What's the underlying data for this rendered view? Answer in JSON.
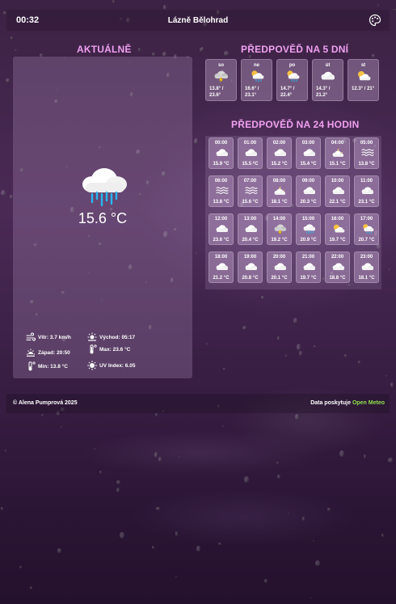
{
  "header": {
    "time": "00:32",
    "city": "Lázně Bělohrad",
    "settings_icon": "palette-icon"
  },
  "current": {
    "title": "AKTUÁLNĚ",
    "icon": "rain-cloud-icon",
    "temperature": "15.6 °C",
    "details": {
      "wind": "Vítr: 3.7 km/h",
      "sunrise": "Východ: 05:17",
      "sunset": "Západ: 20:50",
      "max": "Max: 23.6 °C",
      "min": "Min: 13.8 °C",
      "uv": "UV Index: 6.05"
    }
  },
  "forecast5": {
    "title": "PŘEDPOVĚĎ NA 5 DNÍ",
    "days": [
      {
        "name": "so",
        "icon": "thunder-cloud-icon",
        "temp_line1": "13.8° /",
        "temp_line2": "23.6°"
      },
      {
        "name": "ne",
        "icon": "sun-rain-icon",
        "temp_line1": "16.6° /",
        "temp_line2": "23.1°"
      },
      {
        "name": "po",
        "icon": "sun-rain-icon",
        "temp_line1": "14.7° /",
        "temp_line2": "22.4°"
      },
      {
        "name": "út",
        "icon": "cloud-icon",
        "temp_line1": "14.3° /",
        "temp_line2": "21.2°"
      },
      {
        "name": "st",
        "icon": "sun-cloud-icon",
        "temp_line1": "",
        "temp_line2": "12.3° / 21°"
      }
    ]
  },
  "forecast24": {
    "title": "PŘEDPOVĚĎ NA 24 HODIN",
    "hours": [
      {
        "time": "00:00",
        "icon": "cloud-icon",
        "temp": "15.9 °C"
      },
      {
        "time": "01:00",
        "icon": "cloud-icon",
        "temp": "15.5 °C"
      },
      {
        "time": "02:00",
        "icon": "cloud-icon",
        "temp": "15.2 °C"
      },
      {
        "time": "03:00",
        "icon": "cloud-icon",
        "temp": "15.4 °C"
      },
      {
        "time": "04:00",
        "icon": "moon-cloud-icon",
        "temp": "15.1 °C"
      },
      {
        "time": "05:00",
        "icon": "fog-icon",
        "temp": "13.8 °C"
      },
      {
        "time": "06:00",
        "icon": "fog-icon",
        "temp": "13.8 °C"
      },
      {
        "time": "07:00",
        "icon": "fog-icon",
        "temp": "15.6 °C"
      },
      {
        "time": "08:00",
        "icon": "moon-cloud-icon",
        "temp": "18.1 °C"
      },
      {
        "time": "09:00",
        "icon": "cloud-icon",
        "temp": "20.3 °C"
      },
      {
        "time": "10:00",
        "icon": "cloud-icon",
        "temp": "22.1 °C"
      },
      {
        "time": "11:00",
        "icon": "cloud-icon",
        "temp": "23.1 °C"
      },
      {
        "time": "12:00",
        "icon": "cloud-icon",
        "temp": "23.6 °C"
      },
      {
        "time": "13:00",
        "icon": "cloud-icon",
        "temp": "20.4 °C"
      },
      {
        "time": "14:00",
        "icon": "thunder-cloud-icon",
        "temp": "19.2 °C"
      },
      {
        "time": "15:00",
        "icon": "rain-cloud-icon",
        "temp": "20.9 °C"
      },
      {
        "time": "16:00",
        "icon": "sun-cloud-icon",
        "temp": "19.7 °C"
      },
      {
        "time": "17:00",
        "icon": "sun-rain-icon",
        "temp": "20.7 °C"
      },
      {
        "time": "18:00",
        "icon": "cloud-icon",
        "temp": "21.2 °C"
      },
      {
        "time": "19:00",
        "icon": "cloud-icon",
        "temp": "20.8 °C"
      },
      {
        "time": "20:00",
        "icon": "cloud-icon",
        "temp": "20.1 °C"
      },
      {
        "time": "21:00",
        "icon": "cloud-icon",
        "temp": "19.7 °C"
      },
      {
        "time": "22:00",
        "icon": "cloud-icon",
        "temp": "18.8 °C"
      },
      {
        "time": "23:00",
        "icon": "cloud-icon",
        "temp": "18.1 °C"
      }
    ]
  },
  "footer": {
    "copyright": "© Alena Pumprová 2025",
    "credit_prefix": "Data poskytuje",
    "credit_link": "Open Meteo"
  },
  "colors": {
    "accent_title": "#f0a0f0",
    "link": "#8fe04a"
  }
}
